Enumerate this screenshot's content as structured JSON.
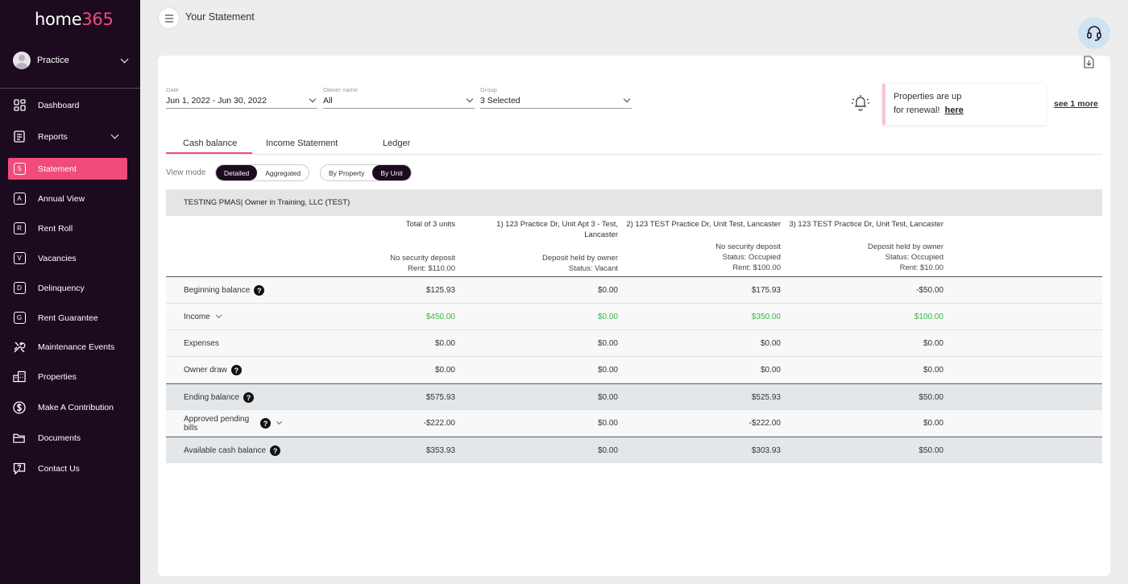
{
  "brand": {
    "logo_text": "home",
    "logo_num": "365"
  },
  "user": {
    "name": "Practice"
  },
  "nav": [
    {
      "label": "Dashboard",
      "icon": "dashboard-icon"
    },
    {
      "label": "Reports",
      "icon": "reports-icon"
    },
    {
      "label": "Statement",
      "icon": "S"
    },
    {
      "label": "Annual View",
      "icon": "A"
    },
    {
      "label": "Rent Roll",
      "icon": "R"
    },
    {
      "label": "Vacancies",
      "icon": "V"
    },
    {
      "label": "Delinquency",
      "icon": "D"
    },
    {
      "label": "Rent Guarantee",
      "icon": "G"
    },
    {
      "label": "Maintenance Events",
      "icon": "tools-icon"
    },
    {
      "label": "Properties",
      "icon": "properties-icon"
    },
    {
      "label": "Make A Contribution",
      "icon": "dollar-icon"
    },
    {
      "label": "Documents",
      "icon": "folder-icon"
    },
    {
      "label": "Contact Us",
      "icon": "chat-icon"
    }
  ],
  "header": {
    "title": "Your Statement"
  },
  "filters": {
    "date": {
      "label": "Date",
      "value": "Jun 1, 2022 - Jun 30, 2022"
    },
    "owner": {
      "label": "Owner name",
      "value": "All"
    },
    "group": {
      "label": "Group",
      "value": "3 Selected"
    }
  },
  "notice": {
    "line1": "Properties are up",
    "line2": "for renewal!",
    "link": "here",
    "see_more": "see 1 more"
  },
  "tabs": [
    "Cash balance",
    "Income Statement",
    "Ledger"
  ],
  "view_mode": {
    "label": "View mode",
    "options": [
      "Detailed",
      "Aggregated"
    ],
    "group_options": [
      "By Property",
      "By Unit"
    ]
  },
  "statement": {
    "owner": "TESTING PMAS| Owner in Training, LLC (TEST)",
    "columns": [
      {
        "title1": "Total of 3 units",
        "title2": "",
        "line1": "",
        "line2": "No security deposit",
        "line3": "Rent: $110.00"
      },
      {
        "title1": "1) 123 Practice Dr, Unit Apt 3 - Test,",
        "title2": "Lancaster",
        "line1": "",
        "line2": "Deposit held by owner",
        "line3": "Status: Vacant"
      },
      {
        "title1": "2) 123 TEST Practice Dr, Unit Test, Lancaster",
        "title2": "",
        "line1": "No security deposit",
        "line2": "Status: Occupied",
        "line3": "Rent: $100.00"
      },
      {
        "title1": "3) 123 TEST Practice Dr, Unit Test, Lancaster",
        "title2": "",
        "line1": "Deposit held by owner",
        "line2": "Status: Occupied",
        "line3": "Rent: $10.00"
      }
    ],
    "rows": [
      {
        "label": "Beginning balance",
        "values": [
          "$125.93",
          "$0.00",
          "$175.93",
          "-$50.00"
        ]
      },
      {
        "label": "Income",
        "values": [
          "$450.00",
          "$0.00",
          "$350.00",
          "$100.00"
        ]
      },
      {
        "label": "Expenses",
        "values": [
          "$0.00",
          "$0.00",
          "$0.00",
          "$0.00"
        ]
      },
      {
        "label": "Owner draw",
        "values": [
          "$0.00",
          "$0.00",
          "$0.00",
          "$0.00"
        ]
      },
      {
        "label": "Ending balance",
        "values": [
          "$575.93",
          "$0.00",
          "$525.93",
          "$50.00"
        ]
      },
      {
        "label": "Approved pending bills",
        "values": [
          "-$222.00",
          "$0.00",
          "-$222.00",
          "$0.00"
        ]
      },
      {
        "label": "Available cash balance",
        "values": [
          "$353.93",
          "$0.00",
          "$303.93",
          "$50.00"
        ]
      }
    ]
  },
  "help_glyph": "?",
  "colors": {
    "sidebar": "#1c0a1f",
    "accent": "#f04b7a",
    "positive": "#3ab54a"
  }
}
